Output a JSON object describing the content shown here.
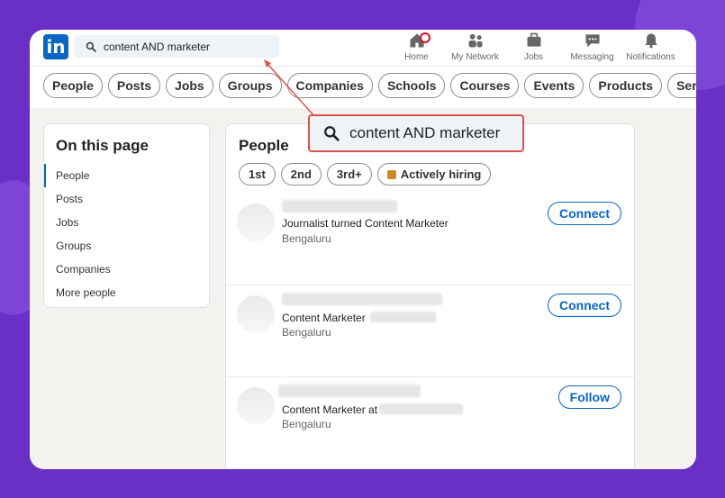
{
  "brand": {
    "logo_text": "in",
    "color": "#0a66c2"
  },
  "search": {
    "value": "content AND marketer",
    "icon": "search-icon"
  },
  "nav": [
    {
      "label": "Home",
      "icon": "home-icon"
    },
    {
      "label": "My Network",
      "icon": "network-icon"
    },
    {
      "label": "Jobs",
      "icon": "briefcase-icon"
    },
    {
      "label": "Messaging",
      "icon": "messaging-icon"
    },
    {
      "label": "Notifications",
      "icon": "bell-icon"
    }
  ],
  "filters": [
    "People",
    "Posts",
    "Jobs",
    "Groups",
    "Companies",
    "Schools",
    "Courses",
    "Events",
    "Products",
    "Services"
  ],
  "sidebar": {
    "title": "On this page",
    "items": [
      "People",
      "Posts",
      "Jobs",
      "Groups",
      "Companies",
      "More people"
    ]
  },
  "main": {
    "title": "People",
    "connection_filters": [
      "1st",
      "2nd",
      "3rd+",
      "Actively hiring"
    ],
    "results": [
      {
        "headline": "Journalist turned Content Marketer",
        "location": "Bengaluru",
        "action": "Connect"
      },
      {
        "headline": "Content Marketer",
        "location": "Bengaluru",
        "action": "Connect"
      },
      {
        "headline": "Content Marketer at",
        "location": "Bengaluru",
        "action": "Follow"
      }
    ]
  },
  "callout": {
    "text": "content AND marketer",
    "border_color": "#d9534f"
  }
}
